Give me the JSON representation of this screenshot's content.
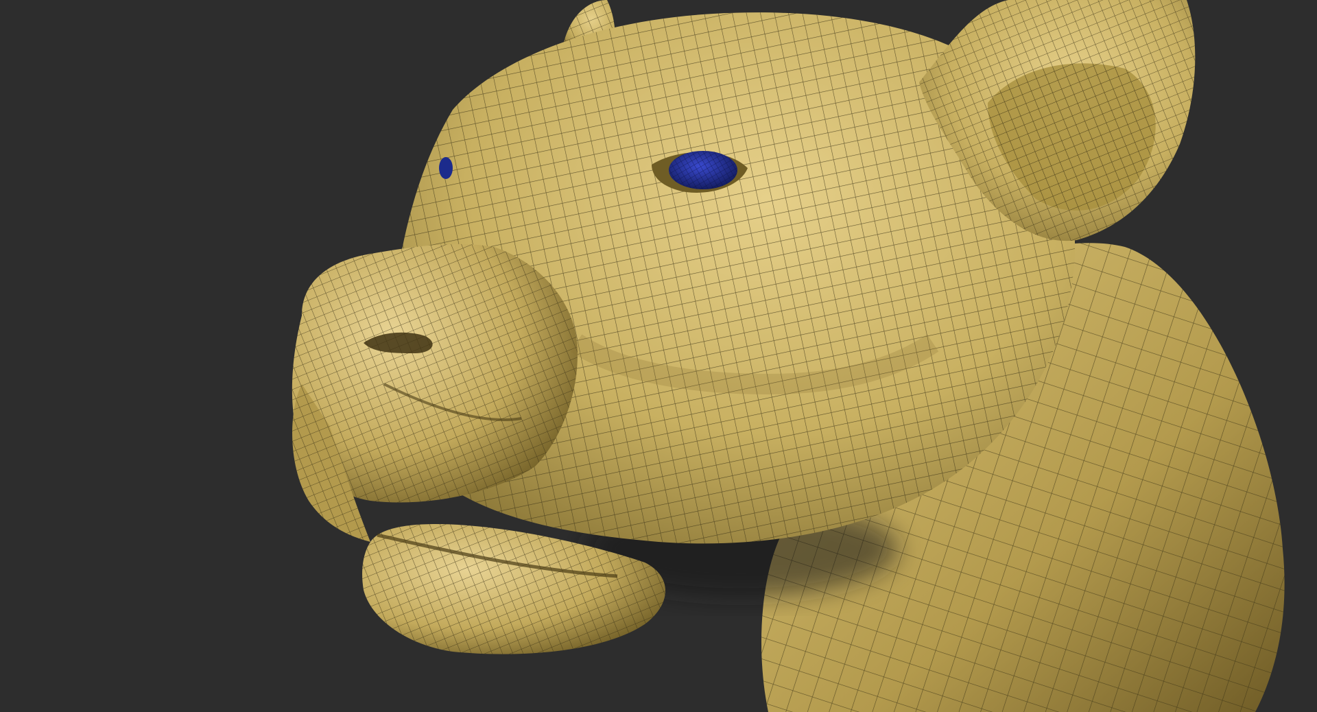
{
  "viewport": {
    "background_color": "#2d2d2d",
    "model": {
      "subject": "lioness-head",
      "display_mode": "polyframe-wireframe-over-shaded",
      "surface_color": "#c8b061",
      "highlight_color": "#e6d08a",
      "shadow_color": "#6d5a26",
      "wire_color": "#3b3316",
      "eye_color": "#1c2b8c",
      "eye_highlight_color": "#3a4ad0"
    }
  }
}
